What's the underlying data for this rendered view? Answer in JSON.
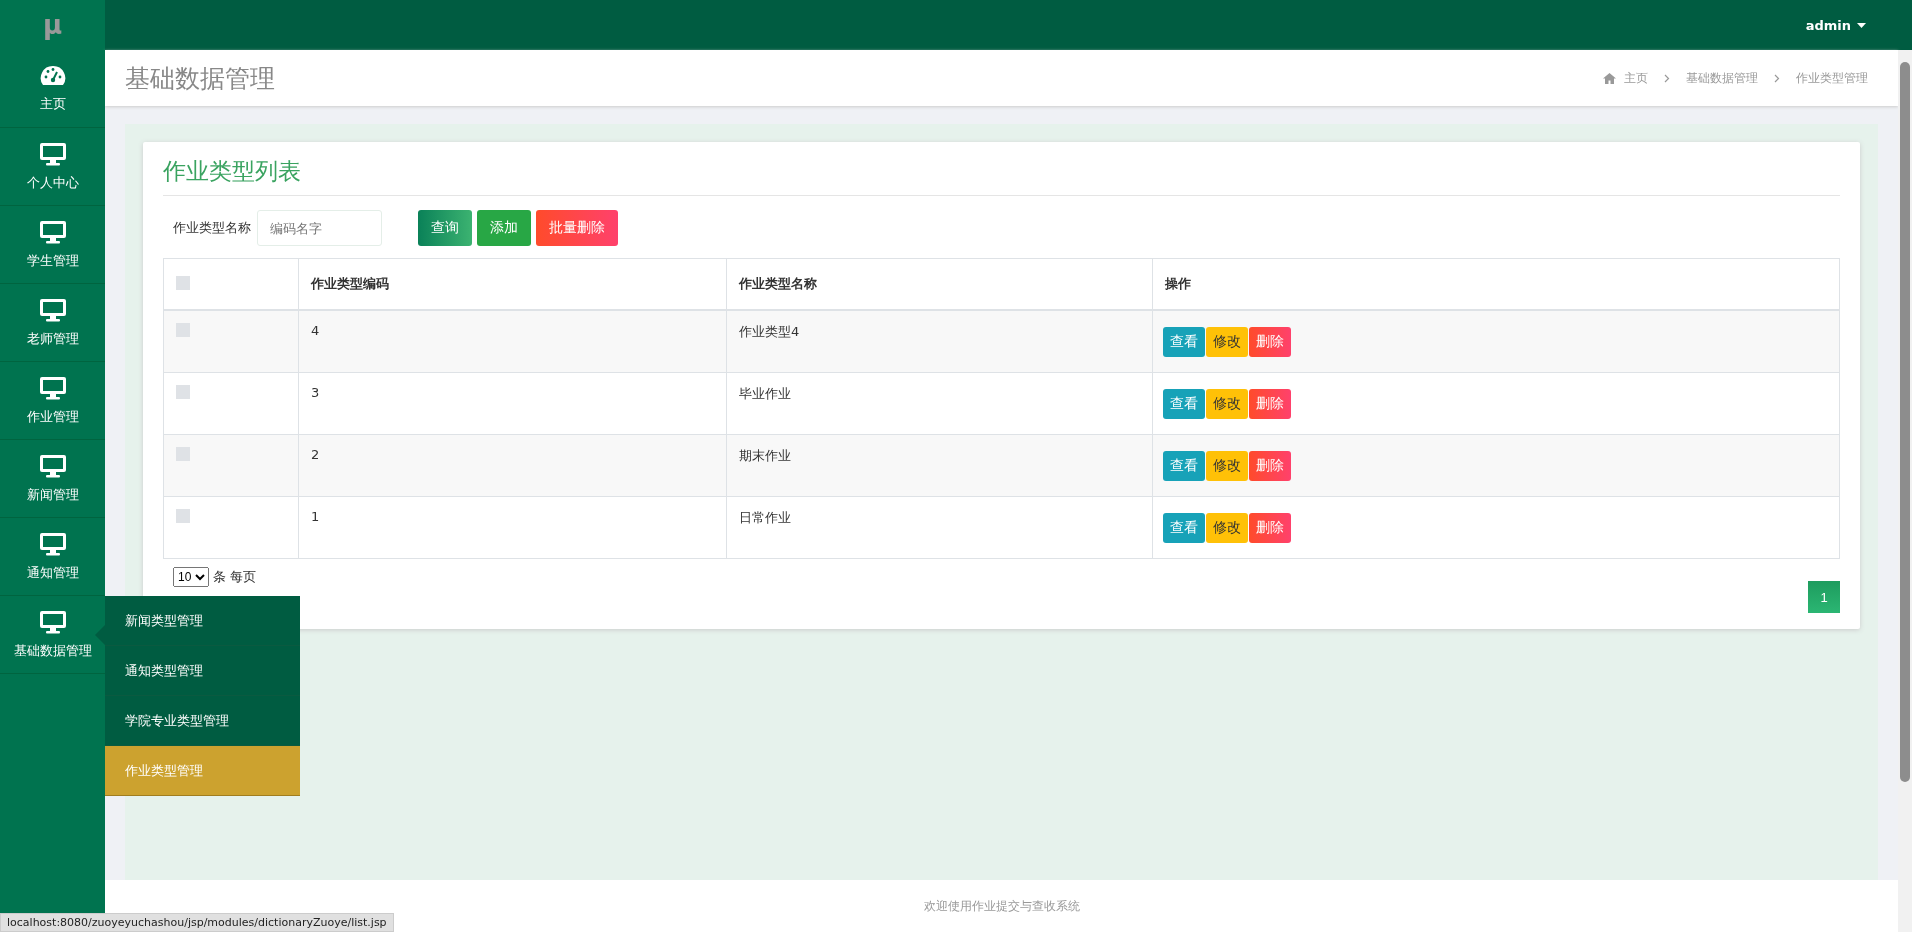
{
  "logo": "μ",
  "user_menu": {
    "label": "admin"
  },
  "sidebar": {
    "items": [
      {
        "label": "主页",
        "kind": "dashboard"
      },
      {
        "label": "个人中心",
        "kind": "page"
      },
      {
        "label": "学生管理",
        "kind": "page"
      },
      {
        "label": "老师管理",
        "kind": "page"
      },
      {
        "label": "作业管理",
        "kind": "page"
      },
      {
        "label": "新闻管理",
        "kind": "page"
      },
      {
        "label": "通知管理",
        "kind": "page"
      },
      {
        "label": "基础数据管理",
        "kind": "page",
        "expanded": true,
        "children": [
          {
            "label": "新闻类型管理",
            "selected": false
          },
          {
            "label": "通知类型管理",
            "selected": false
          },
          {
            "label": "学院专业类型管理",
            "selected": false
          },
          {
            "label": "作业类型管理",
            "selected": true
          }
        ]
      }
    ]
  },
  "page_title": "基础数据管理",
  "breadcrumb": [
    "主页",
    "基础数据管理",
    "作业类型管理"
  ],
  "card": {
    "title": "作业类型列表",
    "search": {
      "label": "作业类型名称",
      "placeholder": "编码名字"
    },
    "buttons": [
      {
        "label": "查询",
        "kind": "search"
      },
      {
        "label": "添加",
        "kind": "add"
      },
      {
        "label": "批量删除",
        "kind": "delete"
      }
    ],
    "table": {
      "all_checked": false,
      "columns": [
        "作业类型编码",
        "作业类型名称",
        "操作"
      ],
      "rows": [
        {
          "checked": false,
          "code": "4",
          "name": "作业类型4",
          "actions": [
            "查看",
            "修改",
            "删除"
          ]
        },
        {
          "checked": false,
          "code": "3",
          "name": "毕业作业",
          "actions": [
            "查看",
            "修改",
            "删除"
          ]
        },
        {
          "checked": false,
          "code": "2",
          "name": "期末作业",
          "actions": [
            "查看",
            "修改",
            "删除"
          ]
        },
        {
          "checked": false,
          "code": "1",
          "name": "日常作业",
          "actions": [
            "查看",
            "修改",
            "删除"
          ]
        }
      ]
    },
    "page_size": {
      "value": "10",
      "label": "条 每页"
    },
    "pagination": [
      {
        "label": "1",
        "selected": true
      }
    ]
  },
  "footer": "欢迎使用作业提交与查收系统",
  "status_bar": "localhost:8080/zuoyeyuchashou/jsp/modules/dictionaryZuoye/list.jsp"
}
